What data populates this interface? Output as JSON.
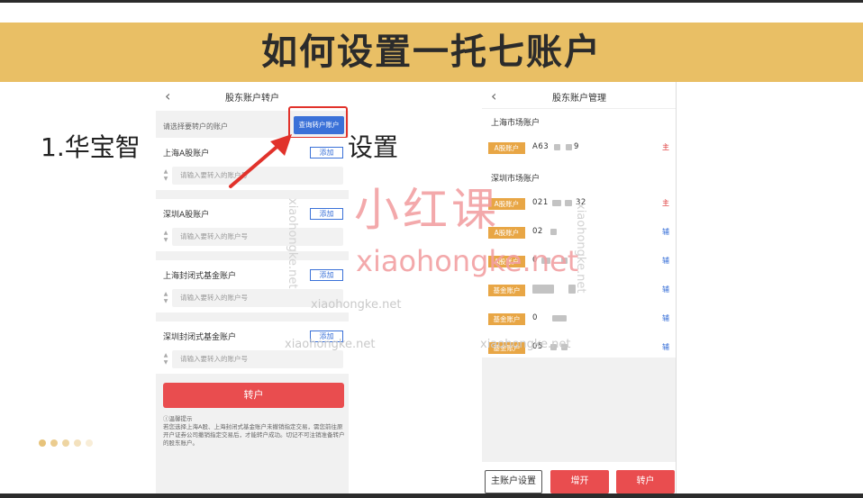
{
  "banner": {
    "title": "如何设置一托七账户"
  },
  "slide": {
    "step_prefix": "1.华宝智",
    "step_suffix": "设置"
  },
  "phone1": {
    "title": "股东账户转户",
    "hint": "请选择要转户的账户",
    "query_button": "查询转户账户",
    "sections": [
      {
        "label": "上海A股账户",
        "add_label": "添加",
        "placeholder": "请输入要转入的账户号"
      },
      {
        "label": "深圳A股账户",
        "add_label": "添加",
        "placeholder": "请输入要转入的账户号"
      },
      {
        "label": "上海封闭式基金账户",
        "add_label": "添加",
        "placeholder": "请输入要转入的账户号"
      },
      {
        "label": "深圳封闭式基金账户",
        "add_label": "添加",
        "placeholder": "请输入要转入的账户号"
      }
    ],
    "transfer_button": "转户",
    "notice_title": "温馨提示",
    "notice_body": "若您选择上海A股、上海封闭式基金账户未撤销指定交易，需您前往原开户证券公司撤销指定交易后，才能转户成功。切记不可注销准备转户的股东账户。"
  },
  "phone2": {
    "title": "股东账户管理",
    "shanghai_label": "上海市场账户",
    "shenzhen_label": "深圳市场账户",
    "shanghai_rows": [
      {
        "tag": "A股账户",
        "account": "A63",
        "tail": "9",
        "role": "主",
        "role_type": "main"
      }
    ],
    "shenzhen_rows": [
      {
        "tag": "A股账户",
        "account": "021",
        "tail": "32",
        "role": "主",
        "role_type": "main"
      },
      {
        "tag": "A股账户",
        "account": "02",
        "tail": "",
        "role": "辅",
        "role_type": "sub"
      },
      {
        "tag": "A股账户",
        "account": "0",
        "tail": "",
        "role": "辅",
        "role_type": "sub"
      },
      {
        "tag": "基金账户",
        "account": "",
        "tail": "",
        "role": "辅",
        "role_type": "sub"
      },
      {
        "tag": "基金账户",
        "account": "0",
        "tail": "",
        "role": "辅",
        "role_type": "sub"
      },
      {
        "tag": "基金账户",
        "account": "05",
        "tail": "",
        "role": "辅",
        "role_type": "sub"
      }
    ],
    "main_set_button": "主账户设置",
    "open_button": "增开",
    "transfer_button": "转户"
  },
  "watermark": {
    "brand": "小红课",
    "url": "xiaohongke.net"
  },
  "colors": {
    "banner": "#e9bf65",
    "accent_red": "#e94d4f",
    "accent_blue": "#3a71d8",
    "tag_orange": "#e8a645",
    "watermark_pink": "#f2a0a3"
  }
}
